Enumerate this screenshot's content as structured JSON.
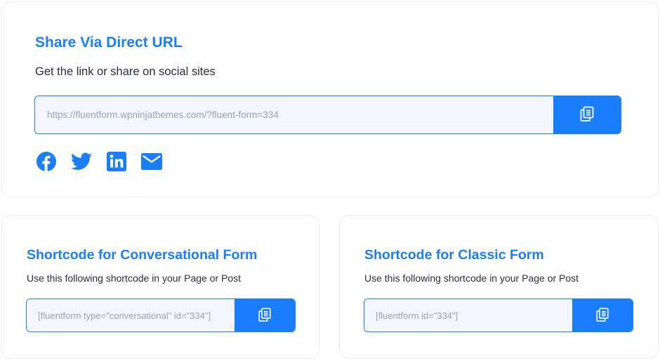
{
  "direct_url": {
    "title": "Share Via Direct URL",
    "subtitle": "Get the link or share on social sites",
    "url_value": "https://fluentform.wpninjathemes.com/?fluent-form=334",
    "copy_icon": "copy-icon",
    "social": [
      {
        "name": "facebook-icon"
      },
      {
        "name": "twitter-icon"
      },
      {
        "name": "linkedin-icon"
      },
      {
        "name": "email-icon"
      }
    ]
  },
  "conversational": {
    "title": "Shortcode for Conversational Form",
    "subtitle": "Use this following shortcode in your Page or Post",
    "shortcode_value": "[fluentform type=\"conversational\" id=\"334\"]",
    "copy_icon": "copy-icon"
  },
  "classic": {
    "title": "Shortcode for Classic Form",
    "subtitle": "Use this following shortcode in your Page or Post",
    "shortcode_value": "[fluentform id=\"334\"]",
    "copy_icon": "copy-icon"
  },
  "colors": {
    "accent": "#1a7efb",
    "field_bg": "#f3f6fe",
    "card_border": "#e3eefc",
    "text": "#2a2f3a",
    "placeholder": "#9aa3b2"
  }
}
